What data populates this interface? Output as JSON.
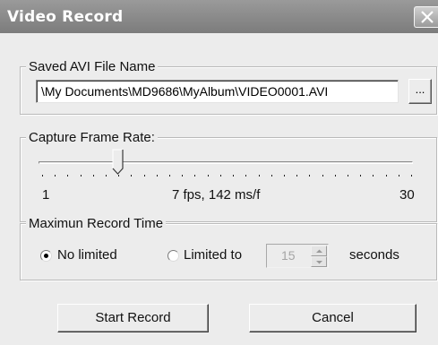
{
  "window": {
    "title": "Video Record"
  },
  "file_group": {
    "legend": "Saved AVI File Name",
    "path_value": "\\My Documents\\MD9686\\MyAlbum\\VIDEO0001.AVI",
    "browse_label": "..."
  },
  "frame_rate_group": {
    "legend": "Capture Frame Rate:",
    "min_label": "1",
    "max_label": "30",
    "current_label": "7 fps, 142 ms/f",
    "slider_value_fps": 7,
    "slider_min": 1,
    "slider_max": 30
  },
  "record_time_group": {
    "legend": "Maximun Record Time",
    "option_unlimited": "No limited",
    "option_limited": "Limited to",
    "selected_option": "No limited",
    "limit_value": "15",
    "unit_label": "seconds"
  },
  "buttons": {
    "start_label": "Start Record",
    "cancel_label": "Cancel"
  },
  "icons": {
    "close": "close-x-icon",
    "slider_thumb": "slider-pointer-icon",
    "spin_up": "arrow-up-icon",
    "spin_down": "arrow-down-icon"
  },
  "colors": {
    "titlebar": "#8a8a8a",
    "dialog_bg": "#ececec",
    "disabled_text": "#a5a5a5"
  }
}
